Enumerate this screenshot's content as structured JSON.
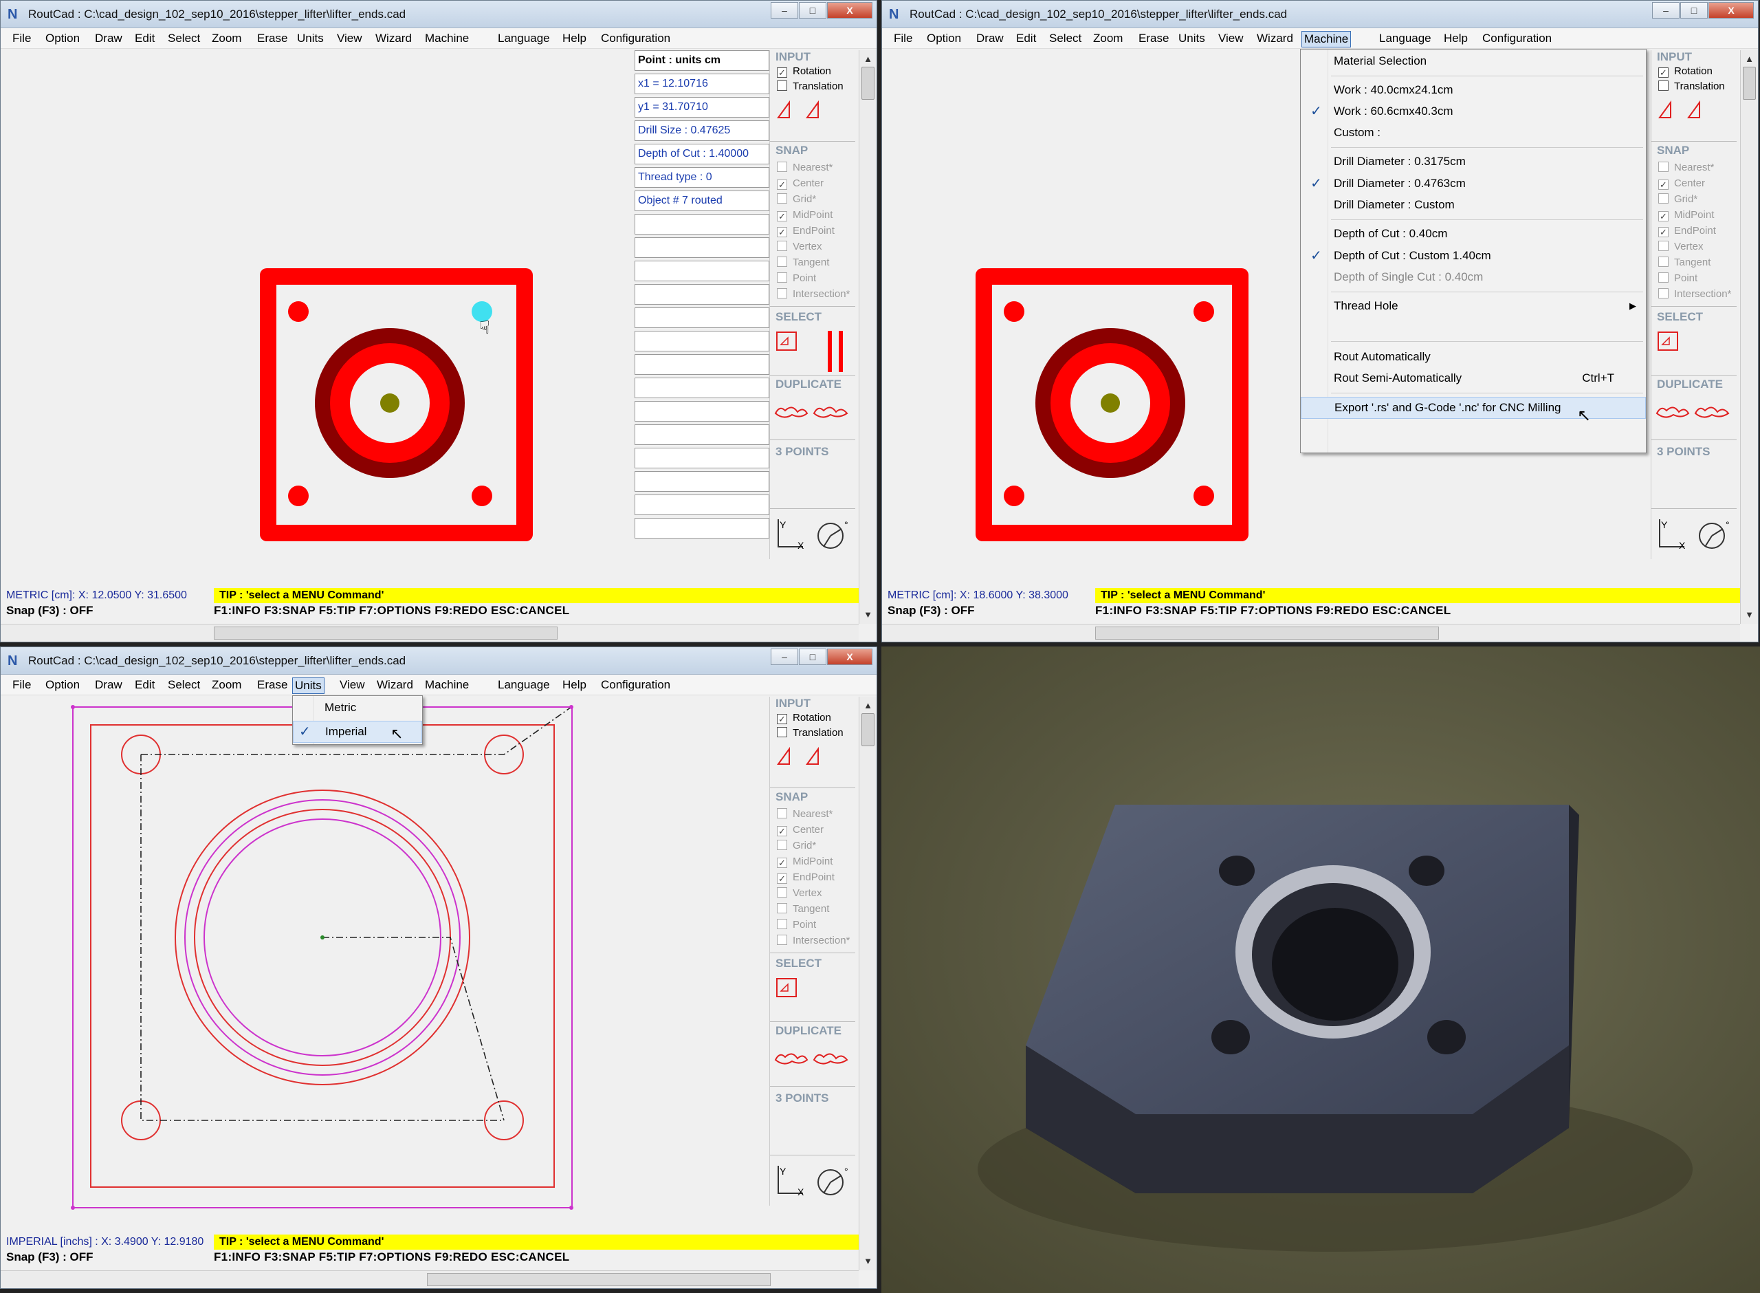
{
  "app": {
    "title": "RoutCad : C:\\cad_design_102_sep10_2016\\stepper_lifter\\lifter_ends.cad",
    "min": "–",
    "max": "□",
    "close": "X"
  },
  "menu": [
    "File",
    "Option",
    "Draw",
    "Edit",
    "Select",
    "Zoom",
    "Erase",
    "Units",
    "View",
    "Wizard",
    "Machine",
    "Language",
    "Help",
    "Configuration"
  ],
  "panel": {
    "input": "INPUT",
    "rotation": "Rotation",
    "translation": "Translation",
    "snap": "SNAP",
    "snap_items": [
      "Nearest*",
      "Center",
      "Grid*",
      "MidPoint",
      "EndPoint",
      "Vertex",
      "Tangent",
      "Point",
      "Intersection*"
    ],
    "select": "SELECT",
    "duplicate": "DUPLICATE",
    "three_points": "3 POINTS",
    "axis_y": "Y",
    "axis_x": "X",
    "angle_sign": "°"
  },
  "status": {
    "tip": "TIP : 'select a MENU Command'",
    "snap": "Snap (F3) : OFF",
    "fkeys": "F1:INFO   F3:SNAP   F5:TIP   F7:OPTIONS   F9:REDO   ESC:CANCEL",
    "coord1": "METRIC [cm]: X: 12.0500  Y: 31.6500",
    "coord2": "METRIC [cm]: X: 18.6000  Y: 38.3000",
    "coord3": "IMPERIAL [inchs] : X: 3.4900  Y: 12.9180"
  },
  "point_panel": {
    "header": "Point : units cm",
    "fields": [
      "x1 = 12.10716",
      "y1 = 31.70710",
      "Drill Size        : 0.47625",
      "Depth of Cut : 1.40000",
      "Thread type   : 0",
      "Object # 7 routed"
    ]
  },
  "machine_menu": {
    "items": [
      {
        "label": "Material Selection"
      },
      {
        "label": "Work : 40.0cmx24.1cm"
      },
      {
        "label": "Work : 60.6cmx40.3cm",
        "checked": true
      },
      {
        "label": "Custom :"
      },
      {
        "label": "Drill Diameter : 0.3175cm"
      },
      {
        "label": "Drill Diameter : 0.4763cm",
        "checked": true
      },
      {
        "label": "Drill Diameter : Custom"
      },
      {
        "label": "Depth of Cut : 0.40cm"
      },
      {
        "label": "Depth of Cut : Custom 1.40cm",
        "checked": true
      },
      {
        "label": "Depth of Single Cut : 0.40cm",
        "disabled": true
      },
      {
        "label": "Thread Hole",
        "submenu": true
      },
      {
        "label": "Rout Automatically"
      },
      {
        "label": "Rout Semi-Automatically",
        "shortcut": "Ctrl+T"
      },
      {
        "label": "Export '.rs' and G-Code '.nc' for CNC Milling",
        "highlight": true
      }
    ],
    "check": "✓",
    "arrow": "▶"
  },
  "units_menu": {
    "items": [
      {
        "label": "Metric"
      },
      {
        "label": "Imperial",
        "checked": true
      }
    ],
    "check": "✓"
  },
  "colors": {
    "part_red": "#ff0000",
    "ring_dark": "#8b0000",
    "center_dot": "#808000",
    "highlight_hole": "#40e0f0",
    "outline_red": "#e03030",
    "toolpath_magenta": "#cc33cc",
    "tip_yellow": "#ffff00"
  }
}
